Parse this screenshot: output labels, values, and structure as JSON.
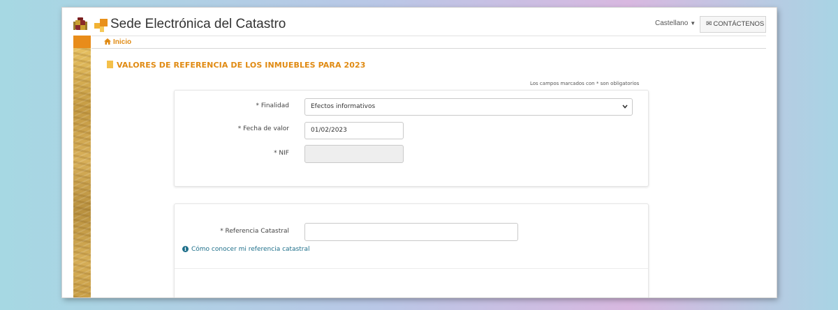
{
  "header": {
    "site_title": "Sede Electrónica del Catastro",
    "language": "Castellano",
    "contact_label": "CONTÁCTENOS"
  },
  "breadcrumb": {
    "home_label": "Inicio"
  },
  "page": {
    "heading": "VALORES DE REFERENCIA DE LOS INMUEBLES PARA 2023",
    "required_note": "Los campos marcados con * son obligatorios"
  },
  "form": {
    "finalidad": {
      "label": "* Finalidad",
      "value": "Efectos informativos"
    },
    "fecha_valor": {
      "label": "* Fecha de valor",
      "value": "01/02/2023"
    },
    "nif": {
      "label": "* NIF",
      "value": ""
    },
    "referencia_catastral": {
      "label": "* Referencia Catastral",
      "value": ""
    },
    "help_link": "Cómo conocer mi referencia catastral"
  },
  "colors": {
    "accent_orange": "#e08a12",
    "link_blue": "#1e6f8a",
    "side_orange": "#e88c1a"
  },
  "icons": [
    "crest-icon",
    "catastro-logo-icon",
    "caret-down-icon",
    "mail-icon",
    "home-icon",
    "document-icon",
    "chevron-down-icon",
    "info-icon"
  ]
}
